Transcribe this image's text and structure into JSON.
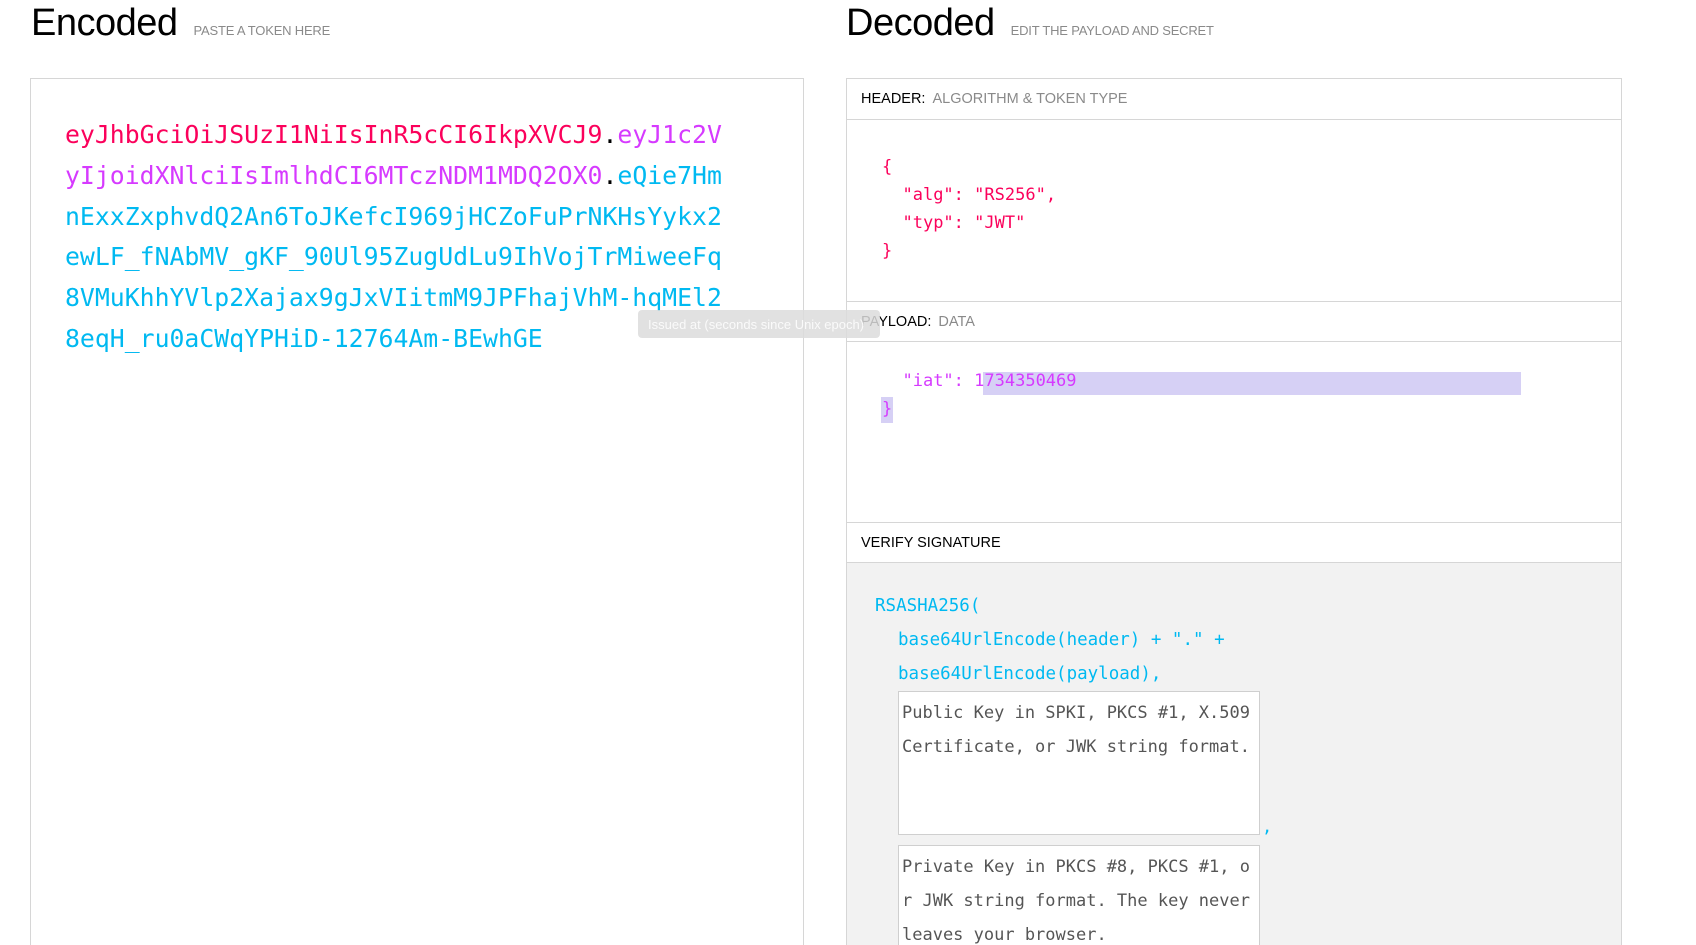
{
  "encoded": {
    "title": "Encoded",
    "subtitle": "PASTE A TOKEN HERE",
    "token": {
      "header": "eyJhbGciOiJSUzI1NiIsInR5cCI6IkpXVCJ9",
      "payload": "eyJ1c2VyIjoidXNlciIsImlhdCI6MTczNDM1MDQ2OX0",
      "signature": "eQie7HmnExxZxphvdQ2An6ToJKefcI969jHCZoFuPrNKHsYykx2ewLF_fNAbMV_gKF_90Ul95ZugUdLu9IhVojTrMiweeFq8VMuKhhYVlp2Xajax9gJxVIitmM9JPFhajVhM-hqMEl28eqH_ru0aCWqYPHiD-12764Am-BEwhGE",
      "dot": "."
    }
  },
  "decoded": {
    "title": "Decoded",
    "subtitle": "EDIT THE PAYLOAD AND SECRET",
    "header_section": {
      "label": "HEADER:",
      "sub": "ALGORITHM & TOKEN TYPE",
      "open": "{",
      "alg_key": "\"alg\"",
      "alg_val": "\"RS256\"",
      "typ_key": "\"typ\"",
      "typ_val": "\"JWT\"",
      "close": "}"
    },
    "payload_section": {
      "label": "PAYLOAD:",
      "sub": "DATA",
      "iat_key": "\"iat\"",
      "iat_val": "1734350469",
      "close": "}"
    },
    "verify_section": {
      "label": "VERIFY SIGNATURE",
      "fn": "RSASHA256(",
      "line1": "base64UrlEncode(header) + \".\" +",
      "line2": "base64UrlEncode(payload),",
      "public_key_placeholder": "Public Key in SPKI, PKCS #1, X.509 Certificate, or JWK string format.",
      "private_key_placeholder": "Private Key in PKCS #8, PKCS #1, or JWK string format. The key never leaves your browser.",
      "comma": ","
    }
  },
  "tooltip": {
    "text": "Issued at (seconds since Unix epoch)"
  }
}
